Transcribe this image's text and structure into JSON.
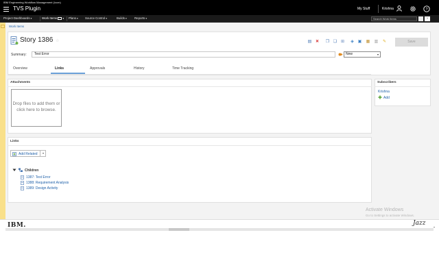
{
  "masthead": {
    "product": "IBM Engineering Workflow Management (/ccm)",
    "title": "TVS Plugin",
    "my_stuff": "My Stuff",
    "user": "Krishna"
  },
  "nav": {
    "items": [
      {
        "label": "Project Dashboards",
        "active": false
      },
      {
        "label": "Work Items",
        "active": true
      },
      {
        "label": "Plans",
        "active": false
      },
      {
        "label": "Source Control",
        "active": false
      },
      {
        "label": "Builds",
        "active": false
      },
      {
        "label": "Reports",
        "active": false
      }
    ],
    "search_placeholder": "Search Work Items"
  },
  "breadcrumb": "Work Items",
  "work_item": {
    "title": "Story 1386",
    "summary_label": "Summary:",
    "summary_value": "Test Error",
    "state": "New",
    "save_label": "Save"
  },
  "tabs": [
    {
      "label": "Overview",
      "active": false
    },
    {
      "label": "Links",
      "active": true
    },
    {
      "label": "Approvals",
      "active": false
    },
    {
      "label": "History",
      "active": false
    },
    {
      "label": "Time Tracking",
      "active": false
    }
  ],
  "attachments": {
    "title": "Attachments",
    "dropzone_text": "Drop files to add them or click here to browse."
  },
  "subscribers": {
    "title": "Subscribers",
    "names": [
      "Krishna"
    ],
    "add_label": "Add"
  },
  "links": {
    "title": "Links",
    "add_related_label": "Add Related",
    "group_label": "Children",
    "children": [
      "1387: Test Error",
      "1388: Requirement Analysis",
      "1389: Design Activity"
    ]
  },
  "watermark": {
    "title": "Activate Windows",
    "subtitle": "Go to Settings to activate Windows."
  },
  "footer": {
    "ibm": "IBM.",
    "jazz": "Jazz"
  },
  "colors": {
    "link": "#1d5fa8",
    "masthead": "#000000",
    "side_strip": "#f9e08a"
  }
}
